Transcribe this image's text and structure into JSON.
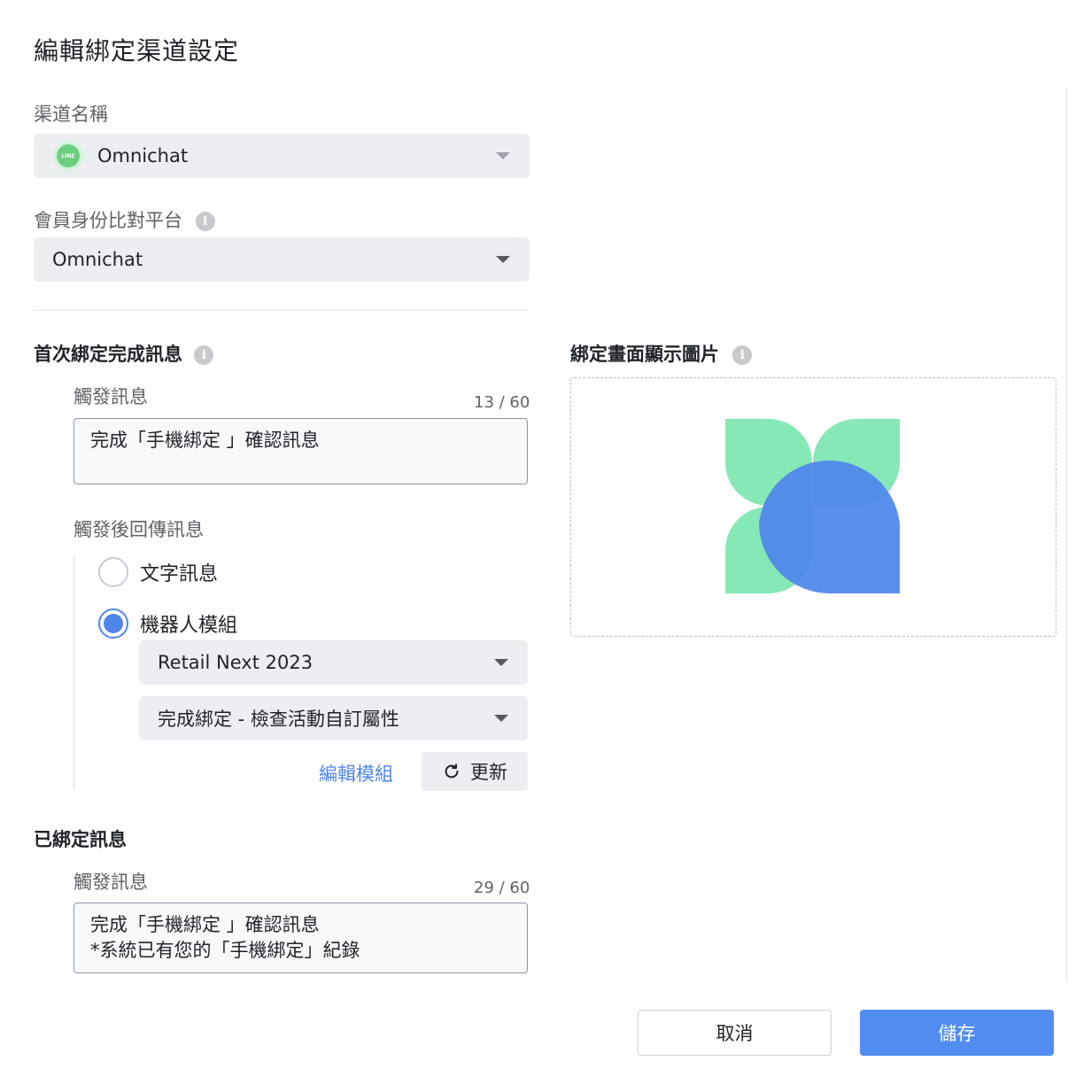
{
  "dialog": {
    "title": "編輯綁定渠道設定"
  },
  "channel": {
    "label": "渠道名稱",
    "value": "Omnichat",
    "icon_text": "LINE"
  },
  "platform": {
    "label": "會員身份比對平台",
    "value": "Omnichat"
  },
  "first_bind": {
    "section_label": "首次綁定完成訊息",
    "trigger_label": "觸發訊息",
    "trigger_counter": "13 / 60",
    "trigger_value": "完成「手機綁定 」確認訊息",
    "reply_label": "觸發後回傳訊息",
    "reply_options": [
      {
        "label": "文字訊息",
        "checked": false
      },
      {
        "label": "機器人模組",
        "checked": true
      }
    ],
    "bot_select": "Retail Next 2023",
    "module_select": "完成綁定 - 檢查活動自訂屬性",
    "edit_module_link": "編輯模組",
    "refresh_button": "更新"
  },
  "already_bound": {
    "section_label": "已綁定訊息",
    "trigger_label": "觸發訊息",
    "trigger_counter": "29 / 60",
    "trigger_line1": "完成「手機綁定 」確認訊息",
    "trigger_line2": "*系統已有您的「手機綁定」紀錄"
  },
  "image_panel": {
    "label": "綁定畫面顯示圖片"
  },
  "footer": {
    "cancel_label": "取消",
    "save_label": "儲存"
  },
  "colors": {
    "accent": "#528cf0",
    "logo_green": "#86e8b6",
    "logo_blue": "#4f86ec"
  }
}
